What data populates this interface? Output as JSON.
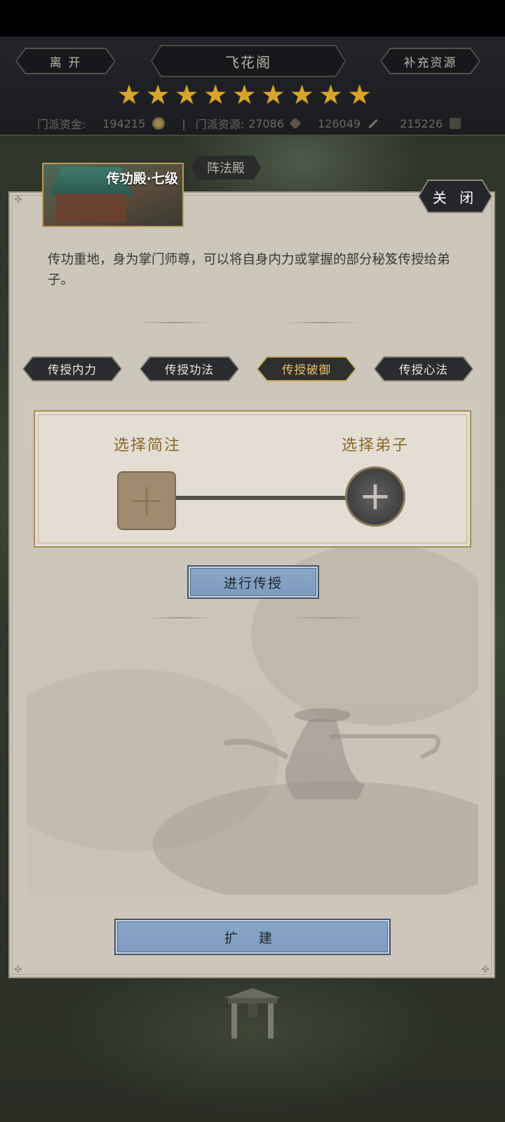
{
  "top_bar": {
    "leave_label": "离 开",
    "sect_name": "飞花阁",
    "replenish_label": "补充资源",
    "star_count": 9,
    "resources": {
      "funds_label": "门派资金:",
      "funds_value": "194215",
      "separator": "|",
      "resource_label": "门派资源:",
      "resource_value": "27086",
      "value_3": "126049",
      "value_4": "215226"
    }
  },
  "background": {
    "hall_tag": "阵法殿"
  },
  "panel": {
    "building_title": "传功殿·七级",
    "close_label": "关 闭",
    "description": "传功重地，身为掌门师尊，可以将自身内力或掌握的部分秘笈传授给弟子。",
    "tabs": [
      {
        "label": "传授内力",
        "active": false
      },
      {
        "label": "传授功法",
        "active": false
      },
      {
        "label": "传授破御",
        "active": true
      },
      {
        "label": "传授心法",
        "active": false
      }
    ],
    "select_item_label": "选择简注",
    "select_disciple_label": "选择弟子",
    "transfer_button": "进行传授",
    "expand_button": "扩 建"
  },
  "colors": {
    "accent_gold": "#c9a95a",
    "star_gold": "#d7a52e",
    "button_blue": "#8aa6c8",
    "panel_bg": "#ccc6bb"
  }
}
